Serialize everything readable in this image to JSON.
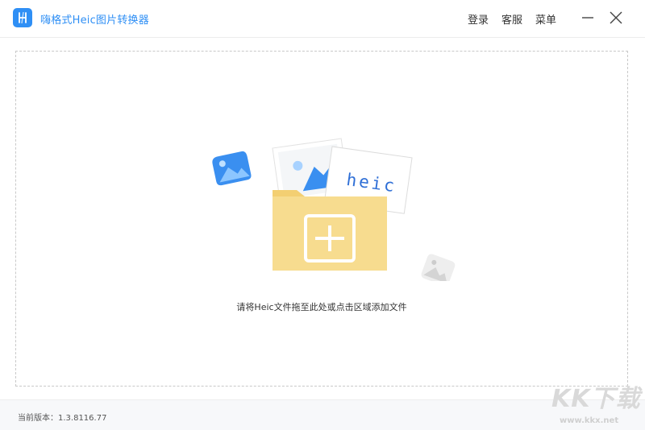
{
  "app": {
    "title": "嗨格式Heic图片转换器",
    "logo_icon": "app-logo-icon"
  },
  "header": {
    "login_label": "登录",
    "support_label": "客服",
    "menu_label": "菜单"
  },
  "window_controls": {
    "minimize_icon": "minimize-icon",
    "close_icon": "close-icon"
  },
  "drop_zone": {
    "hint": "请将Heic文件拖至此处或点击区域添加文件",
    "card_label": "heic",
    "add_icon": "plus-icon"
  },
  "footer": {
    "version_label": "当前版本：1.3.8116.77"
  },
  "watermark": {
    "logo_text": "KK下载",
    "url": "www.kkx.net"
  },
  "colors": {
    "accent": "#2f8ff5",
    "folder": "#f6d98a",
    "folder_tab": "#f3cf72"
  }
}
